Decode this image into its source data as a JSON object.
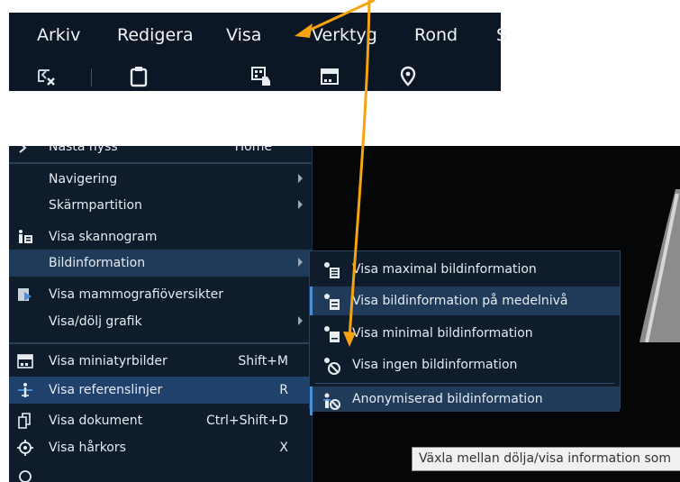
{
  "menubar": {
    "items": [
      {
        "label": "Arkiv"
      },
      {
        "label": "Redigera"
      },
      {
        "label": "Visa"
      },
      {
        "label": "Verktyg"
      },
      {
        "label": "Rond"
      },
      {
        "label": "S"
      }
    ],
    "toolbar_icons": [
      "close-study-icon",
      "clipboard-icon",
      "image-hand-icon",
      "thumbnail-icon",
      "location-pin-icon"
    ]
  },
  "menu": {
    "items": [
      {
        "label": "Nästa hyss",
        "shortcut": "Home"
      },
      {
        "label": "Navigering",
        "submenu": true
      },
      {
        "label": "Skärmpartition",
        "submenu": true
      },
      {
        "label": "Visa skannogram",
        "icon": "scanogram-icon"
      },
      {
        "label": "Bildinformation",
        "submenu": true
      },
      {
        "label": "Visa mammografiöversikter",
        "icon": "mammography-icon"
      },
      {
        "label": "Visa/dölj grafik",
        "submenu": true
      },
      {
        "label": "Visa miniatyrbilder",
        "shortcut": "Shift+M",
        "icon": "thumbnails-icon"
      },
      {
        "label": "Visa referenslinjer",
        "shortcut": "R",
        "icon": "reference-lines-icon"
      },
      {
        "label": "Visa dokument",
        "shortcut": "Ctrl+Shift+D",
        "icon": "document-icon"
      },
      {
        "label": "Visa hårkors",
        "shortcut": "X",
        "icon": "crosshair-icon"
      }
    ]
  },
  "submenu": {
    "items": [
      {
        "label": "Visa maximal bildinformation"
      },
      {
        "label": "Visa bildinformation på medelnivå"
      },
      {
        "label": "Visa minimal bildinformation"
      },
      {
        "label": "Visa ingen bildinformation"
      },
      {
        "label": "Anonymiserad bildinformation"
      }
    ]
  },
  "tooltip": {
    "text": "Växla mellan dölja/visa information som"
  },
  "colors": {
    "menu_bg": "#0e1c2b",
    "highlight": "#1f3b59",
    "accent": "#4a90d9",
    "arrow": "#f5a40f"
  }
}
